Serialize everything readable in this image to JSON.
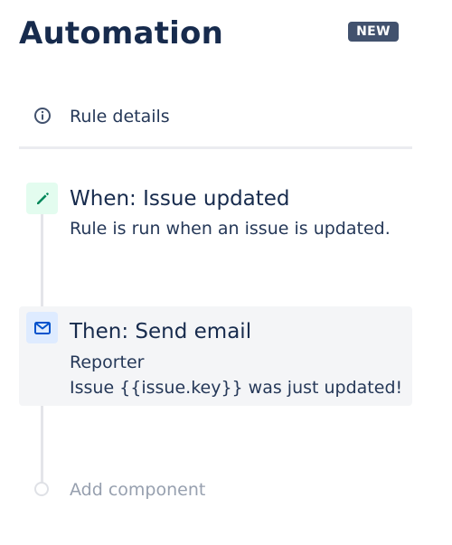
{
  "header": {
    "title": "Automation",
    "badge": "NEW"
  },
  "rule_details": {
    "icon": "info-icon",
    "label": "Rule details"
  },
  "steps": [
    {
      "kind": "trigger",
      "icon": "pencil-icon",
      "icon_color": "#00875a",
      "title": "When: Issue updated",
      "lines": [
        "Rule is run when an issue is updated."
      ]
    },
    {
      "kind": "action",
      "icon": "envelope-icon",
      "icon_color": "#0052cc",
      "title": "Then: Send email",
      "lines": [
        "Reporter",
        "Issue {{issue.key}} was just updated!"
      ]
    }
  ],
  "add_component": {
    "label": "Add component"
  },
  "colors": {
    "title_text": "#172b4d",
    "badge_bg": "#42526e",
    "selected_step_bg": "#f4f5f7",
    "muted_text": "#97a0af"
  }
}
